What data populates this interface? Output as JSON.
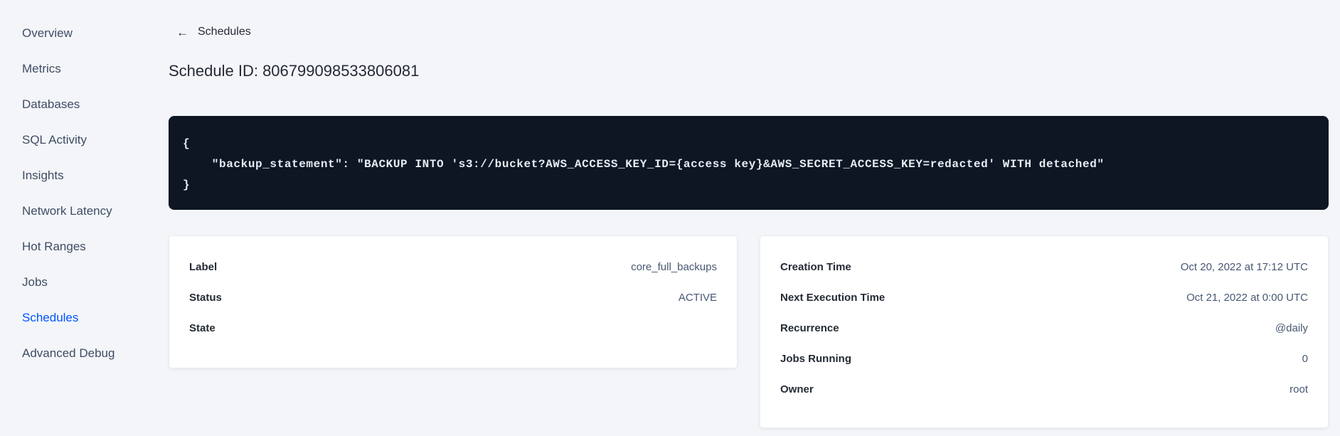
{
  "colors": {
    "page_bg": "#f3f5f9",
    "accent_blue": "#0055ff",
    "code_bg": "#0e1624",
    "code_text": "#e7ecf3",
    "text_dark": "#242a35",
    "text_slate": "#475872"
  },
  "sidebar": {
    "items": [
      {
        "label": "Overview",
        "active": false
      },
      {
        "label": "Metrics",
        "active": false
      },
      {
        "label": "Databases",
        "active": false
      },
      {
        "label": "SQL Activity",
        "active": false
      },
      {
        "label": "Insights",
        "active": false
      },
      {
        "label": "Network Latency",
        "active": false
      },
      {
        "label": "Hot Ranges",
        "active": false
      },
      {
        "label": "Jobs",
        "active": false
      },
      {
        "label": "Schedules",
        "active": true
      },
      {
        "label": "Advanced Debug",
        "active": false
      }
    ]
  },
  "header": {
    "back_icon": "←",
    "back_label": "Schedules",
    "title": "Schedule ID: 806799098533806081"
  },
  "code_block": {
    "lines": [
      "{",
      "    \"backup_statement\": \"BACKUP INTO 's3://bucket?AWS_ACCESS_KEY_ID={access key}&AWS_SECRET_ACCESS_KEY=redacted' WITH detached\"",
      "}"
    ]
  },
  "details_left": {
    "rows": [
      {
        "label": "Label",
        "value": "core_full_backups"
      },
      {
        "label": "Status",
        "value": "ACTIVE"
      },
      {
        "label": "State",
        "value": ""
      }
    ]
  },
  "details_right": {
    "rows": [
      {
        "label": "Creation Time",
        "value": "Oct 20, 2022 at 17:12 UTC"
      },
      {
        "label": "Next Execution Time",
        "value": "Oct 21, 2022 at 0:00 UTC"
      },
      {
        "label": "Recurrence",
        "value": "@daily"
      },
      {
        "label": "Jobs Running",
        "value": "0"
      },
      {
        "label": "Owner",
        "value": "root"
      }
    ]
  }
}
